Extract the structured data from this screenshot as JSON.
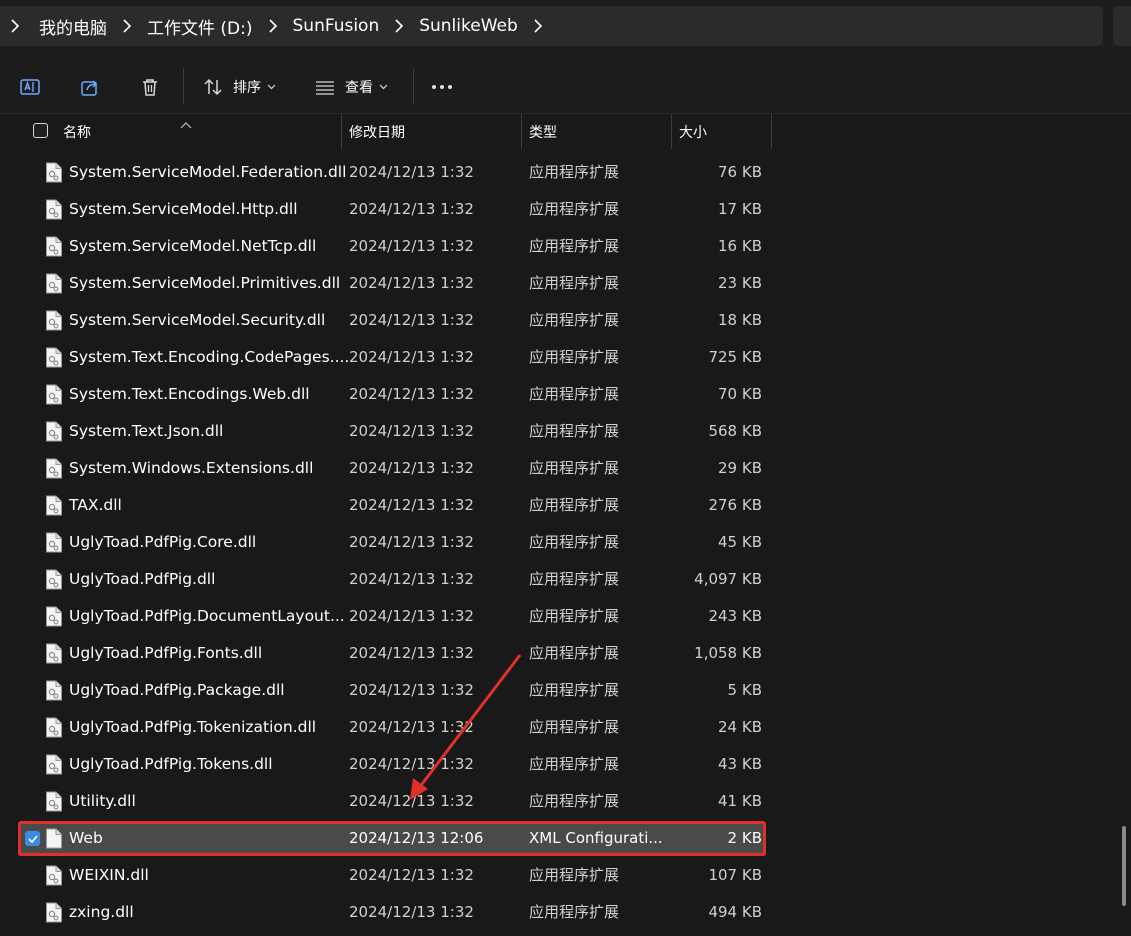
{
  "breadcrumb": {
    "items": [
      "我的电脑",
      "工作文件 (D:)",
      "SunFusion",
      "SunlikeWeb"
    ]
  },
  "toolbar": {
    "sort_label": "排序",
    "view_label": "查看"
  },
  "columns": {
    "name": "名称",
    "modified": "修改日期",
    "type": "类型",
    "size": "大小"
  },
  "files": [
    {
      "name": "System.ServiceModel.Federation.dll",
      "modified": "2024/12/13 1:32",
      "type": "应用程序扩展",
      "size": "76 KB"
    },
    {
      "name": "System.ServiceModel.Http.dll",
      "modified": "2024/12/13 1:32",
      "type": "应用程序扩展",
      "size": "17 KB"
    },
    {
      "name": "System.ServiceModel.NetTcp.dll",
      "modified": "2024/12/13 1:32",
      "type": "应用程序扩展",
      "size": "16 KB"
    },
    {
      "name": "System.ServiceModel.Primitives.dll",
      "modified": "2024/12/13 1:32",
      "type": "应用程序扩展",
      "size": "23 KB"
    },
    {
      "name": "System.ServiceModel.Security.dll",
      "modified": "2024/12/13 1:32",
      "type": "应用程序扩展",
      "size": "18 KB"
    },
    {
      "name": "System.Text.Encoding.CodePages....",
      "modified": "2024/12/13 1:32",
      "type": "应用程序扩展",
      "size": "725 KB"
    },
    {
      "name": "System.Text.Encodings.Web.dll",
      "modified": "2024/12/13 1:32",
      "type": "应用程序扩展",
      "size": "70 KB"
    },
    {
      "name": "System.Text.Json.dll",
      "modified": "2024/12/13 1:32",
      "type": "应用程序扩展",
      "size": "568 KB"
    },
    {
      "name": "System.Windows.Extensions.dll",
      "modified": "2024/12/13 1:32",
      "type": "应用程序扩展",
      "size": "29 KB"
    },
    {
      "name": "TAX.dll",
      "modified": "2024/12/13 1:32",
      "type": "应用程序扩展",
      "size": "276 KB"
    },
    {
      "name": "UglyToad.PdfPig.Core.dll",
      "modified": "2024/12/13 1:32",
      "type": "应用程序扩展",
      "size": "45 KB"
    },
    {
      "name": "UglyToad.PdfPig.dll",
      "modified": "2024/12/13 1:32",
      "type": "应用程序扩展",
      "size": "4,097 KB"
    },
    {
      "name": "UglyToad.PdfPig.DocumentLayout...",
      "modified": "2024/12/13 1:32",
      "type": "应用程序扩展",
      "size": "243 KB"
    },
    {
      "name": "UglyToad.PdfPig.Fonts.dll",
      "modified": "2024/12/13 1:32",
      "type": "应用程序扩展",
      "size": "1,058 KB"
    },
    {
      "name": "UglyToad.PdfPig.Package.dll",
      "modified": "2024/12/13 1:32",
      "type": "应用程序扩展",
      "size": "5 KB"
    },
    {
      "name": "UglyToad.PdfPig.Tokenization.dll",
      "modified": "2024/12/13 1:32",
      "type": "应用程序扩展",
      "size": "24 KB"
    },
    {
      "name": "UglyToad.PdfPig.Tokens.dll",
      "modified": "2024/12/13 1:32",
      "type": "应用程序扩展",
      "size": "43 KB"
    },
    {
      "name": "Utility.dll",
      "modified": "2024/12/13 1:32",
      "type": "应用程序扩展",
      "size": "41 KB"
    },
    {
      "name": "Web",
      "modified": "2024/12/13 12:06",
      "type": "XML Configurati...",
      "size": "2 KB",
      "selected": true
    },
    {
      "name": "WEIXIN.dll",
      "modified": "2024/12/13 1:32",
      "type": "应用程序扩展",
      "size": "107 KB"
    },
    {
      "name": "zxing.dll",
      "modified": "2024/12/13 1:32",
      "type": "应用程序扩展",
      "size": "494 KB"
    }
  ],
  "colors": {
    "background": "#191919",
    "selection": "#4a4a4a",
    "highlight_box": "#e0302a",
    "checkbox_accent": "#3b8ae6"
  }
}
